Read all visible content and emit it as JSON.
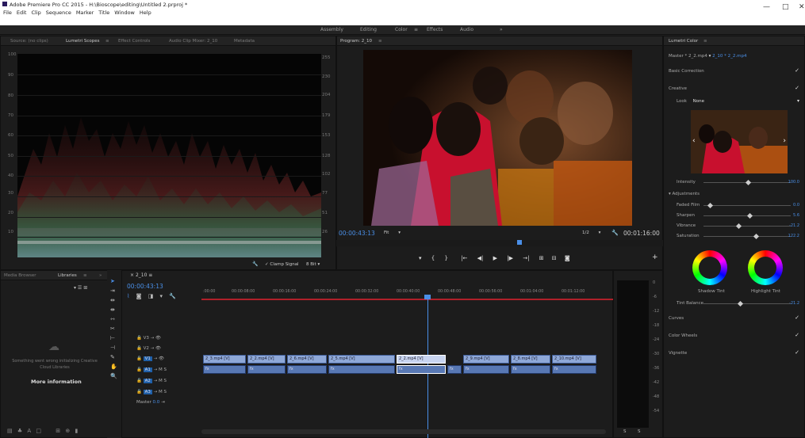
{
  "window": {
    "title": "Adobe Premiere Pro CC 2015 - H:\\Bioscope\\editing\\Untitled 2.prproj *",
    "controls": [
      "—",
      "□",
      "✕"
    ]
  },
  "menu": [
    "File",
    "Edit",
    "Clip",
    "Sequence",
    "Marker",
    "Title",
    "Window",
    "Help"
  ],
  "workspaces": {
    "items": [
      "Assembly",
      "Editing",
      "Color",
      "Effects",
      "Audio"
    ],
    "active": "Color",
    "more": "»"
  },
  "scopes": {
    "tabs": [
      "Source: (no clips)",
      "Lumetri Scopes",
      "Effect Controls",
      "Audio Clip Mixer: 2_10",
      "Metadata"
    ],
    "active_tab": "Lumetri Scopes",
    "left_axis": [
      "100",
      "90",
      "80",
      "70",
      "60",
      "50",
      "40",
      "30",
      "20",
      "10"
    ],
    "right_axis": [
      "255",
      "230",
      "204",
      "179",
      "153",
      "128",
      "102",
      "77",
      "51",
      "26"
    ],
    "clamp_signal": "Clamp Signal",
    "bit_depth": "8 Bit"
  },
  "program": {
    "title": "Program: 2_10",
    "timecode": "00:00:43:13",
    "fit": "Fit",
    "ratio": "1/2",
    "duration": "00:01:16:00",
    "transport": [
      "▾",
      "{",
      "}",
      "|←",
      "◀|",
      "▶",
      "|▶",
      "→|",
      "⊞",
      "⊟",
      "◙"
    ],
    "add": "+"
  },
  "lumetri": {
    "title": "Lumetri Color",
    "master": "Master * 2_2.mp4",
    "clip": "2_10 * 2_2.mp4",
    "sections": [
      "Basic Correction",
      "Creative",
      "Curves",
      "Color Wheels",
      "Vignette"
    ],
    "look_label": "Look",
    "look_value": "None",
    "intensity": {
      "label": "Intensity",
      "value": "100.0"
    },
    "adjustments": "Adjustments",
    "sliders": [
      {
        "label": "Faded Film",
        "value": "0.0"
      },
      {
        "label": "Sharpen",
        "value": "5.6"
      },
      {
        "label": "Vibrance",
        "value": "-21.2"
      },
      {
        "label": "Saturation",
        "value": "122.2"
      }
    ],
    "shadow_tint": "Shadow Tint",
    "highlight_tint": "Highlight Tint",
    "tint_balance": {
      "label": "Tint Balance",
      "value": "-21.2"
    }
  },
  "libraries": {
    "tabs": [
      "Media Browser",
      "Libraries"
    ],
    "active": "Libraries",
    "message": "Something went wrong initializing Creative Cloud Libraries",
    "link": "More information"
  },
  "timeline": {
    "tab": "2_10",
    "timecode": "00:00:43:13",
    "ruler": [
      ":00:00",
      "00:00:08:00",
      "00:00:16:00",
      "00:00:24:00",
      "00:00:32:00",
      "00:00:40:00",
      "00:00:48:00",
      "00:00:56:00",
      "00:01:04:00",
      "00:01:12:00"
    ],
    "tracks": [
      {
        "name": "V3"
      },
      {
        "name": "V2"
      },
      {
        "name": "V1",
        "active": true
      },
      {
        "name": "A1",
        "active": true
      },
      {
        "name": "A2"
      },
      {
        "name": "A3"
      }
    ],
    "master_label": "Master",
    "master_value": "0.0",
    "video_clips": [
      "2_3.mp4 [V]",
      "2_2.mp4 [V]",
      "2_6.mp4 [V]",
      "2_5.mp4 [V]",
      "2_2.mp4 [V]",
      "2_9.mp4 [V]",
      "2_8.mp4 [V]",
      "2_10.mp4 [V]"
    ]
  },
  "meters": {
    "scale": [
      "0",
      "-6",
      "-12",
      "-18",
      "-24",
      "-30",
      "-36",
      "-42",
      "-48",
      "-54"
    ],
    "labels": [
      "S",
      "S"
    ]
  }
}
